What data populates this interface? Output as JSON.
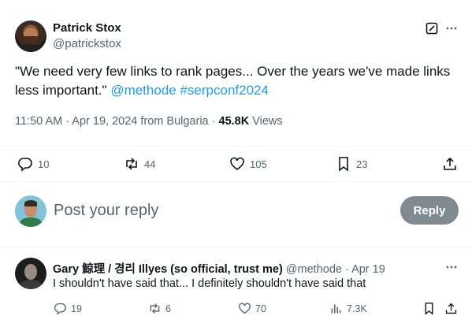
{
  "tweet": {
    "author_name": "Patrick Stox",
    "author_handle": "@patrickstox",
    "text_part1": "\"We need very few links to rank pages... Over the years we've made links less important.\" ",
    "mention": "@methode",
    "hashtag": "#serpconf2024",
    "time": "11:50 AM",
    "sep1": " · ",
    "date": "Apr 19, 2024",
    "source": " from Bulgaria",
    "sep2": " · ",
    "views_count": "45.8K",
    "views_label": " Views",
    "icons": {
      "grok": "grok-icon",
      "more": "more-icon"
    }
  },
  "actions": {
    "replies": "10",
    "reposts": "44",
    "likes": "105",
    "bookmarks": "23"
  },
  "composer": {
    "placeholder": "Post your reply",
    "button_label": "Reply"
  },
  "reply": {
    "author_name": "Gary 鯨理 / 경리 Illyes (so official, trust me)",
    "author_handle": " @methode",
    "sep": " · ",
    "date": "Apr 19",
    "text": "I shouldn't have said that... I definitely shouldn't have said that",
    "replies": "19",
    "reposts": "6",
    "likes": "70",
    "views": "7.3K"
  },
  "colors": {
    "link": "#1d9bf0",
    "muted": "#536471",
    "reply_button": "#7f8b91"
  }
}
